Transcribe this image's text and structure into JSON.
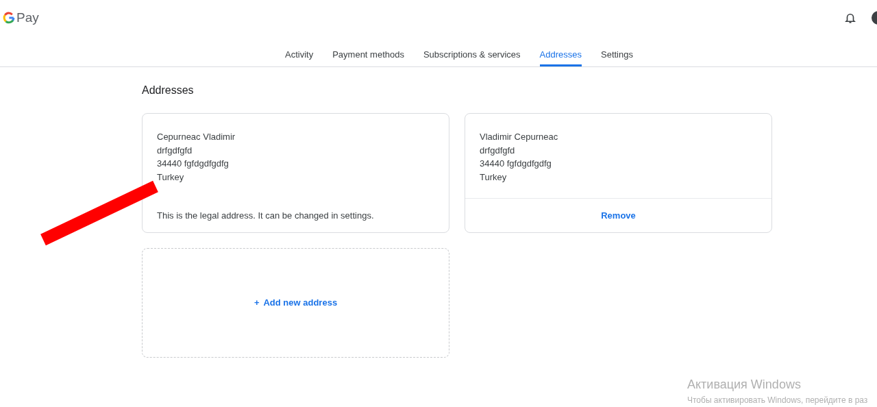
{
  "header": {
    "logo_text": "Pay"
  },
  "tabs": [
    {
      "label": "Activity",
      "selected": false
    },
    {
      "label": "Payment methods",
      "selected": false
    },
    {
      "label": "Subscriptions & services",
      "selected": false
    },
    {
      "label": "Addresses",
      "selected": true
    },
    {
      "label": "Settings",
      "selected": false
    }
  ],
  "page_title": "Addresses",
  "addresses": [
    {
      "kind": "legal",
      "lines": [
        "Cepurneac Vladimir",
        "drfgdfgfd",
        "34440 fgfdgdfgdfg",
        "Turkey"
      ],
      "note": "This is the legal address. It can be changed in settings."
    },
    {
      "kind": "removable",
      "lines": [
        "Vladimir Cepurneac",
        "drfgdfgfd",
        "34440 fgfdgdfgdfg",
        "Turkey"
      ],
      "action": "Remove"
    }
  ],
  "add_address": {
    "icon": "+",
    "label": "Add new address"
  },
  "os_notice": {
    "title": "Активация Windows",
    "text": "Чтобы активировать Windows, перейдите в раз"
  }
}
